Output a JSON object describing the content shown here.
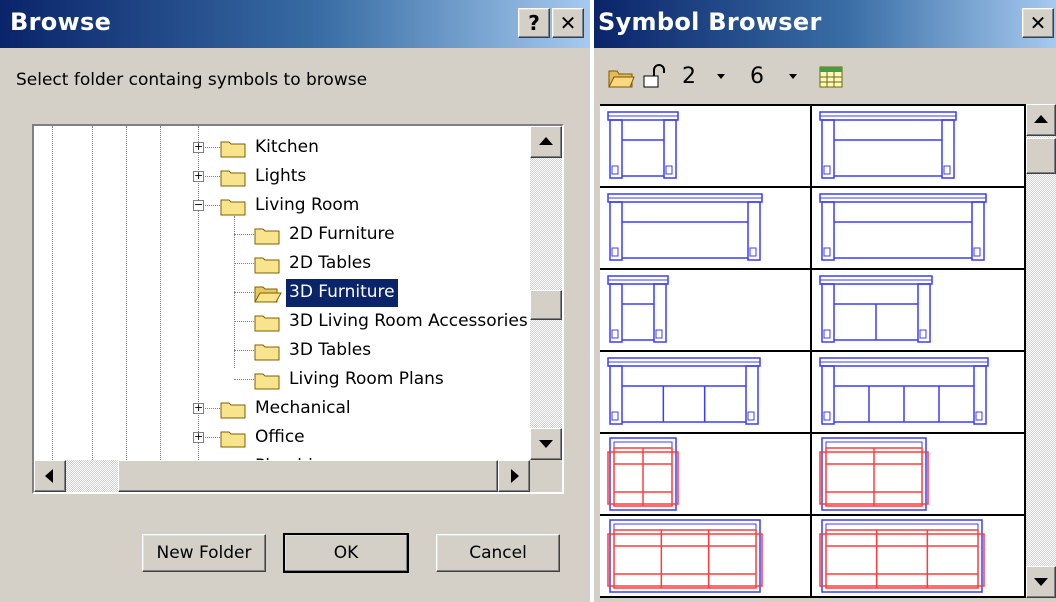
{
  "browse": {
    "title": "Browse",
    "help_glyph": "?",
    "close_glyph": "✕",
    "instruction": "Select folder containg symbols to browse",
    "tree": [
      {
        "label": "Kitchen",
        "level": 1,
        "expander": "+"
      },
      {
        "label": "Lights",
        "level": 1,
        "expander": "+"
      },
      {
        "label": "Living Room",
        "level": 1,
        "expander": "−",
        "open": true
      },
      {
        "label": "2D Furniture",
        "level": 2
      },
      {
        "label": "2D Tables",
        "level": 2
      },
      {
        "label": "3D Furniture",
        "level": 2,
        "selected": true
      },
      {
        "label": "3D Living Room Accessories",
        "level": 2
      },
      {
        "label": "3D Tables",
        "level": 2
      },
      {
        "label": "Living Room Plans",
        "level": 2
      },
      {
        "label": "Mechanical",
        "level": 1,
        "expander": "+"
      },
      {
        "label": "Office",
        "level": 1,
        "expander": "+"
      },
      {
        "label": "Plumbing",
        "level": 1,
        "expander": "+"
      }
    ],
    "buttons": {
      "new_folder": "New Folder",
      "ok": "OK",
      "cancel": "Cancel"
    }
  },
  "symbol_browser": {
    "title": "Symbol Browser",
    "close_glyph": "✕",
    "columns_value": "2",
    "rows_value": "6",
    "symbols": [
      [
        "sofa-front-small",
        "sofa-front-small"
      ],
      [
        "sofa-front-long",
        "sofa-front-long-alt"
      ],
      [
        "chair-front",
        "loveseat-front"
      ],
      [
        "sofa-three-front",
        "sofa-four-front"
      ],
      [
        "loveseat-plan-red",
        "loveseat-plan-red-alt"
      ],
      [
        "sofa-plan-red",
        "sofa-plan-red-alt"
      ]
    ]
  },
  "colors": {
    "title_start": "#0a246a",
    "title_end": "#a6caf0",
    "selection": "#0a246a",
    "symbol_blue": "#3c3cff",
    "symbol_red": "#ff3c3c",
    "folder_yellow": "#f8e48c"
  }
}
